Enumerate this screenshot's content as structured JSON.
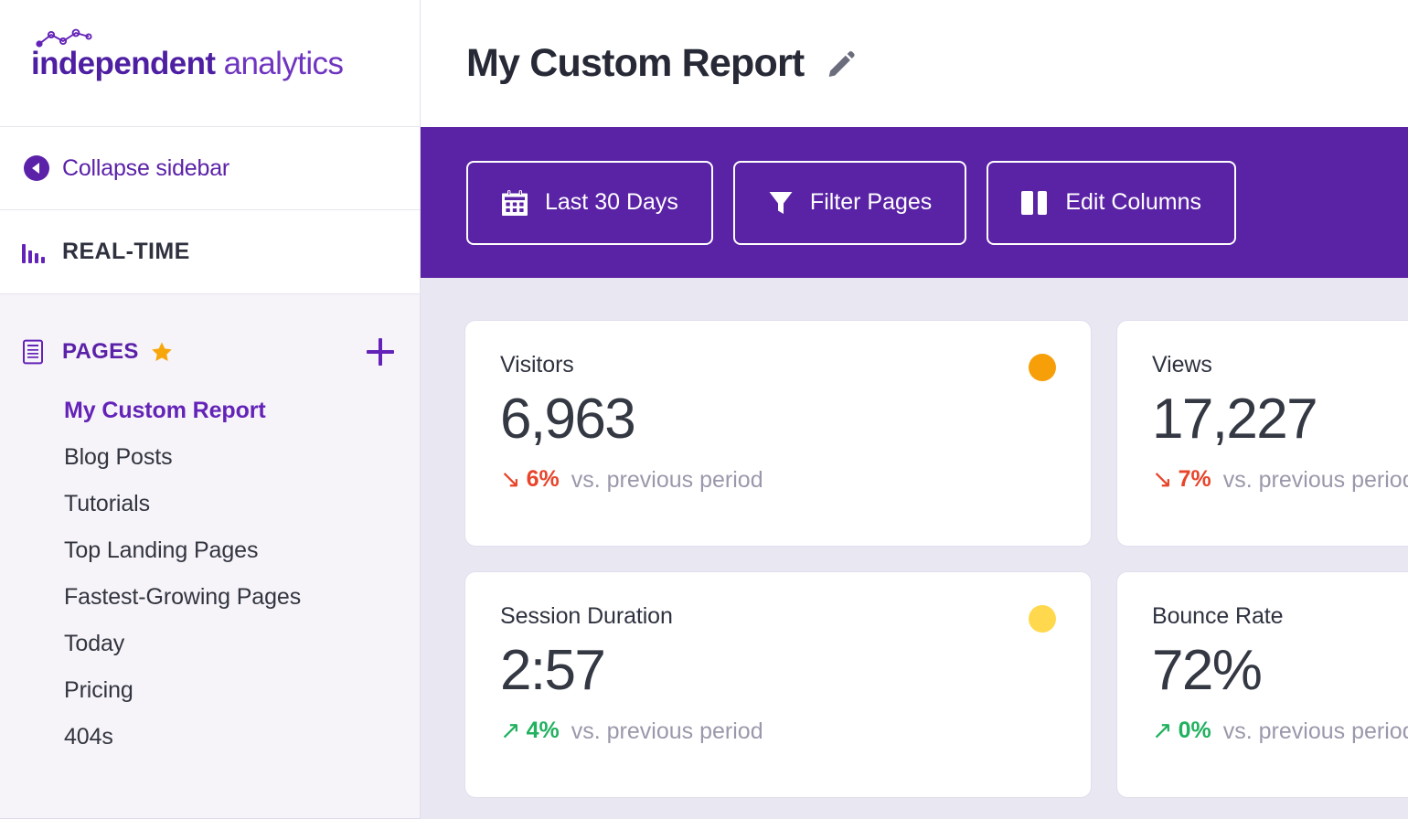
{
  "sidebar": {
    "logo": {
      "bold_text": "independent",
      "light_text": " analytics",
      "mark": "line-chart-logo-mark"
    },
    "collapse": {
      "label": "Collapse sidebar",
      "icon": "chevron-left-circle-icon"
    },
    "realtime": {
      "label": "REAL-TIME",
      "icon": "bar-chart-icon"
    },
    "pages_section": {
      "title": "PAGES",
      "doc_icon": "document-list-icon",
      "star_icon": "star-icon",
      "add_icon": "plus-icon",
      "items": [
        {
          "label": "My Custom Report",
          "active": true
        },
        {
          "label": "Blog Posts",
          "active": false
        },
        {
          "label": "Tutorials",
          "active": false
        },
        {
          "label": "Top Landing Pages",
          "active": false
        },
        {
          "label": "Fastest-Growing Pages",
          "active": false
        },
        {
          "label": "Today",
          "active": false
        },
        {
          "label": "Pricing",
          "active": false
        },
        {
          "label": "404s",
          "active": false
        }
      ]
    }
  },
  "header": {
    "title": "My Custom Report",
    "edit_icon": "pencil-icon"
  },
  "toolbar": {
    "date_range_label": "Last 30 Days",
    "date_range_icon": "calendar-icon",
    "filter_label": "Filter Pages",
    "filter_icon": "funnel-icon",
    "columns_label": "Edit Columns",
    "columns_icon": "columns-icon",
    "background_color": "#5a22a5"
  },
  "stats": {
    "comparison_note": "vs. previous period",
    "cards": [
      {
        "label": "Visitors",
        "value": "6,963",
        "dot_color": "#f79f09",
        "change_value": "6%",
        "change_direction": "down",
        "change_arrow": "↘",
        "change_color": "#e8442a",
        "note": "vs. previous period"
      },
      {
        "label": "Views",
        "value": "17,227",
        "dot_color": "#f79f09",
        "change_value": "7%",
        "change_direction": "down",
        "change_arrow": "↘",
        "change_color": "#e8442a",
        "note": "vs. previous period"
      },
      {
        "label": "Session Duration",
        "value": "2:57",
        "dot_color": "#ffd84d",
        "change_value": "4%",
        "change_direction": "up",
        "change_arrow": "↗",
        "change_color": "#21b15f",
        "note": "vs. previous period"
      },
      {
        "label": "Bounce Rate",
        "value": "72%",
        "dot_color": "#ffd84d",
        "change_value": "0%",
        "change_direction": "up",
        "change_arrow": "↗",
        "change_color": "#21b15f",
        "note": "vs. previous period"
      }
    ]
  }
}
